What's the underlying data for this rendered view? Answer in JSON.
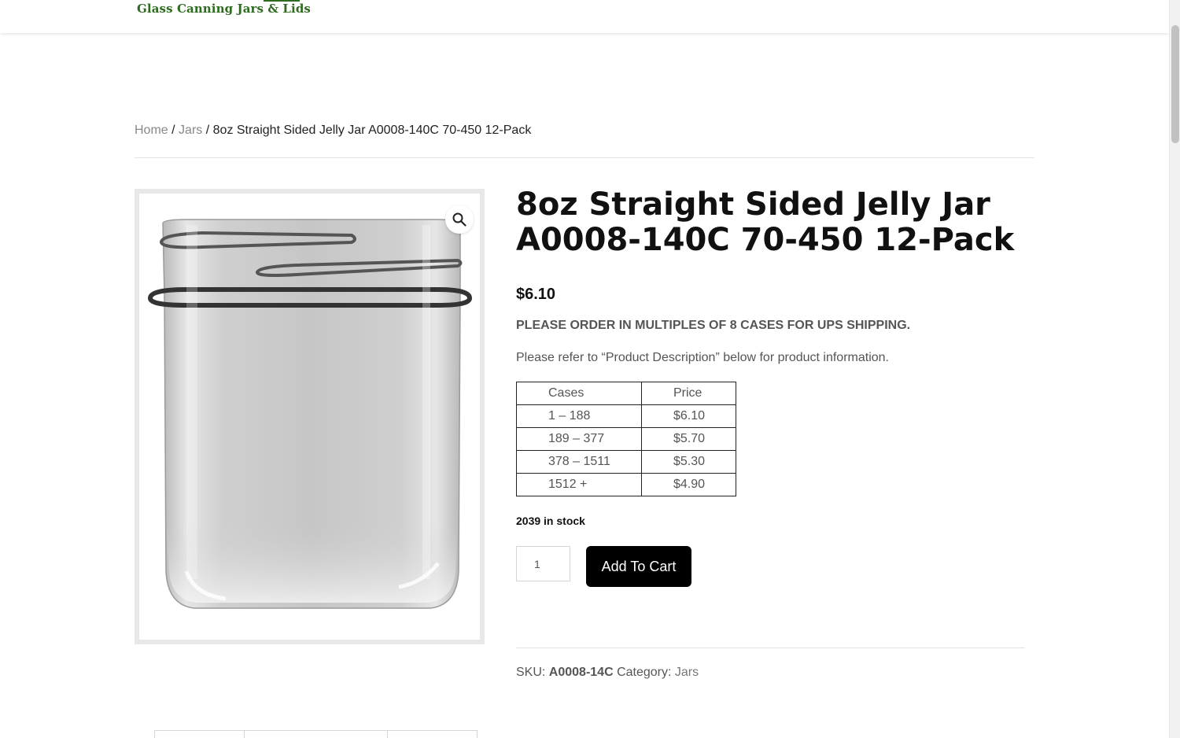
{
  "header": {
    "logo_text": "Glass Canning Jars & Lids"
  },
  "breadcrumb": {
    "home": "Home",
    "sep1": "/",
    "category": "Jars",
    "sep2": "/",
    "current": "8oz Straight Sided Jelly Jar A0008-140C 70-450 12-Pack"
  },
  "product": {
    "title": "8oz Straight Sided Jelly Jar A0008-140C 70-450 12-Pack",
    "price": "$6.10",
    "notice": "PLEASE ORDER IN MULTIPLES OF 8 CASES FOR UPS SHIPPING.",
    "refer": "Please refer to “Product Description” below for product information.",
    "price_table": {
      "headers": [
        "Cases",
        "Price"
      ],
      "rows": [
        [
          "1 – 188",
          "$6.10"
        ],
        [
          "189 – 377",
          "$5.70"
        ],
        [
          "378 – 1511",
          "$5.30"
        ],
        [
          "1512 +",
          "$4.90"
        ]
      ]
    },
    "stock": "2039 in stock",
    "quantity": "1",
    "add_to_cart": "Add To Cart",
    "sku_label": "SKU:",
    "sku_value": "A0008-14C",
    "category_label": "Category:",
    "category_value": "Jars",
    "zoom_icon": "magnifier-icon"
  }
}
